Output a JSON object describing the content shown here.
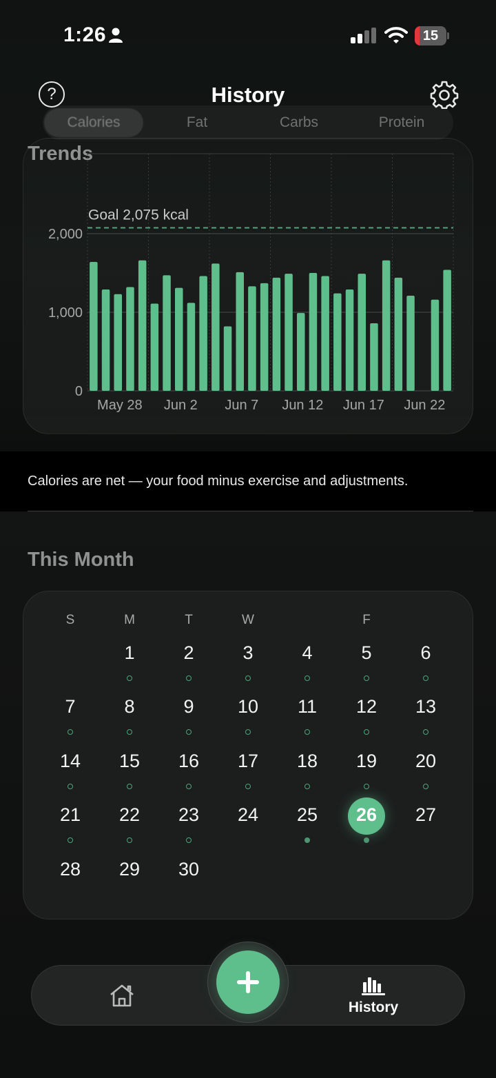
{
  "status_bar": {
    "time": "1:26",
    "battery": "15",
    "battery_level": 0.15
  },
  "header": {
    "title": "History",
    "help_symbol": "?"
  },
  "segments": [
    {
      "label": "Calories",
      "active": true
    },
    {
      "label": "Fat",
      "active": false
    },
    {
      "label": "Carbs",
      "active": false
    },
    {
      "label": "Protein",
      "active": false
    }
  ],
  "trends": {
    "title": "Trends",
    "goal_label": "Goal 2,075 kcal"
  },
  "chart_data": {
    "type": "bar",
    "title": "",
    "xlabel": "",
    "ylabel": "",
    "ylim": [
      0,
      2400
    ],
    "yticks": [
      0,
      1000,
      2000
    ],
    "ytick_labels": [
      "0",
      "1,000",
      "2,000"
    ],
    "xtick_labels": [
      "May 28",
      "Jun 2",
      "Jun 7",
      "Jun 12",
      "Jun 17",
      "Jun 22"
    ],
    "goal": 2075,
    "categories": [
      "May 28",
      "May 29",
      "May 30",
      "May 31",
      "Jun 1",
      "Jun 2",
      "Jun 3",
      "Jun 4",
      "Jun 5",
      "Jun 6",
      "Jun 7",
      "Jun 8",
      "Jun 9",
      "Jun 10",
      "Jun 11",
      "Jun 12",
      "Jun 13",
      "Jun 14",
      "Jun 15",
      "Jun 16",
      "Jun 17",
      "Jun 18",
      "Jun 19",
      "Jun 20",
      "Jun 21",
      "Jun 22",
      "Jun 23",
      "Jun 24",
      "Jun 25",
      "Jun 26"
    ],
    "values": [
      1640,
      1290,
      1230,
      1320,
      1660,
      1110,
      1470,
      1310,
      1120,
      1460,
      1620,
      820,
      1510,
      1330,
      1370,
      1440,
      1490,
      990,
      1500,
      1460,
      1240,
      1290,
      1490,
      860,
      1660,
      1440,
      1210,
      0,
      1160,
      1540
    ],
    "grid": true,
    "bar_color": "#5fbf8c"
  },
  "note": "Calories are net — your food minus exercise and adjustments.",
  "month": {
    "title": "This Month",
    "weekdays": [
      "S",
      "M",
      "T",
      "W",
      "",
      "F",
      ""
    ],
    "days": [
      {
        "n": "1",
        "col": 1,
        "row": 0,
        "dot": "hollow"
      },
      {
        "n": "2",
        "col": 2,
        "row": 0,
        "dot": "hollow"
      },
      {
        "n": "3",
        "col": 3,
        "row": 0,
        "dot": "hollow"
      },
      {
        "n": "4",
        "col": 4,
        "row": 0,
        "dot": "hollow"
      },
      {
        "n": "5",
        "col": 5,
        "row": 0,
        "dot": "hollow"
      },
      {
        "n": "6",
        "col": 6,
        "row": 0,
        "dot": "hollow"
      },
      {
        "n": "7",
        "col": 0,
        "row": 1,
        "dot": "hollow"
      },
      {
        "n": "8",
        "col": 1,
        "row": 1,
        "dot": "hollow"
      },
      {
        "n": "9",
        "col": 2,
        "row": 1,
        "dot": "hollow"
      },
      {
        "n": "10",
        "col": 3,
        "row": 1,
        "dot": "hollow"
      },
      {
        "n": "11",
        "col": 4,
        "row": 1,
        "dot": "hollow"
      },
      {
        "n": "12",
        "col": 5,
        "row": 1,
        "dot": "hollow"
      },
      {
        "n": "13",
        "col": 6,
        "row": 1,
        "dot": "hollow"
      },
      {
        "n": "14",
        "col": 0,
        "row": 2,
        "dot": "hollow"
      },
      {
        "n": "15",
        "col": 1,
        "row": 2,
        "dot": "hollow"
      },
      {
        "n": "16",
        "col": 2,
        "row": 2,
        "dot": "hollow"
      },
      {
        "n": "17",
        "col": 3,
        "row": 2,
        "dot": "hollow"
      },
      {
        "n": "18",
        "col": 4,
        "row": 2,
        "dot": "hollow"
      },
      {
        "n": "19",
        "col": 5,
        "row": 2,
        "dot": "hollow"
      },
      {
        "n": "20",
        "col": 6,
        "row": 2,
        "dot": "hollow"
      },
      {
        "n": "21",
        "col": 0,
        "row": 3,
        "dot": "hollow"
      },
      {
        "n": "22",
        "col": 1,
        "row": 3,
        "dot": "hollow"
      },
      {
        "n": "23",
        "col": 2,
        "row": 3,
        "dot": "hollow"
      },
      {
        "n": "24",
        "col": 3,
        "row": 3,
        "dot": ""
      },
      {
        "n": "25",
        "col": 4,
        "row": 3,
        "dot": "filled"
      },
      {
        "n": "26",
        "col": 5,
        "row": 3,
        "dot": "filled",
        "today": true
      },
      {
        "n": "27",
        "col": 6,
        "row": 3,
        "dot": ""
      },
      {
        "n": "28",
        "col": 0,
        "row": 4,
        "dot": ""
      },
      {
        "n": "29",
        "col": 1,
        "row": 4,
        "dot": ""
      },
      {
        "n": "30",
        "col": 2,
        "row": 4,
        "dot": ""
      }
    ]
  },
  "tabbar": {
    "history_label": "History"
  },
  "colors": {
    "accent": "#5fbf8c",
    "background": "#0c0d0d",
    "card": "#1c1e1e"
  },
  "icons": [
    "person-icon",
    "signal-icon",
    "wifi-icon",
    "battery-icon",
    "help-icon",
    "gear-icon",
    "home-icon",
    "history-chart-icon",
    "plus-icon"
  ]
}
